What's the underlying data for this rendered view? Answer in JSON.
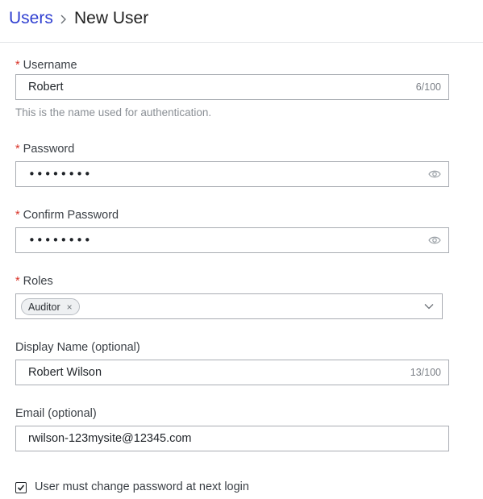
{
  "breadcrumb": {
    "parent": "Users",
    "current": "New User"
  },
  "form": {
    "username": {
      "label": "Username",
      "required_mark": "*",
      "value": "Robert",
      "counter": "6/100",
      "hint": "This is the name used for authentication."
    },
    "password": {
      "label": "Password",
      "required_mark": "*",
      "masked": "••••••••",
      "icon": "eye-icon"
    },
    "confirm_password": {
      "label": "Confirm Password",
      "required_mark": "*",
      "masked": "••••••••",
      "icon": "eye-icon"
    },
    "roles": {
      "label": "Roles",
      "required_mark": "*",
      "tags": [
        "Auditor"
      ],
      "remove_glyph": "×"
    },
    "display_name": {
      "label": "Display Name (optional)",
      "value": "Robert Wilson",
      "counter": "13/100"
    },
    "email": {
      "label": "Email (optional)",
      "value": "rwilson-123mysite@12345.com"
    },
    "must_change_password": {
      "label": "User must change password at next login",
      "checked": true
    }
  },
  "colors": {
    "link": "#2f3fd1",
    "required": "#d93025",
    "border": "#a9adb3",
    "hint": "#8a8f95"
  }
}
